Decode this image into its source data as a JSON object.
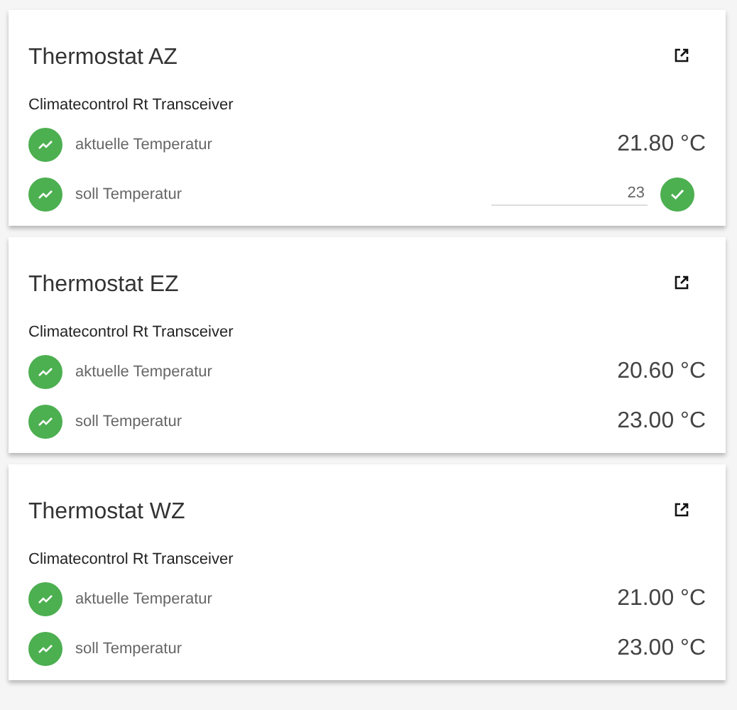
{
  "cards": [
    {
      "title": "Thermostat AZ",
      "device": "Climatecontrol Rt Transceiver",
      "rows": [
        {
          "kind": "value",
          "label": "aktuelle Temperatur",
          "value": "21.80 °C"
        },
        {
          "kind": "input",
          "label": "soll Temperatur",
          "value": "23"
        }
      ]
    },
    {
      "title": "Thermostat EZ",
      "device": "Climatecontrol Rt Transceiver",
      "rows": [
        {
          "kind": "value",
          "label": "aktuelle Temperatur",
          "value": "20.60 °C"
        },
        {
          "kind": "value",
          "label": "soll Temperatur",
          "value": "23.00 °C"
        }
      ]
    },
    {
      "title": "Thermostat WZ",
      "device": "Climatecontrol Rt Transceiver",
      "rows": [
        {
          "kind": "value",
          "label": "aktuelle Temperatur",
          "value": "21.00 °C"
        },
        {
          "kind": "value",
          "label": "soll Temperatur",
          "value": "23.00 °C"
        }
      ]
    }
  ]
}
